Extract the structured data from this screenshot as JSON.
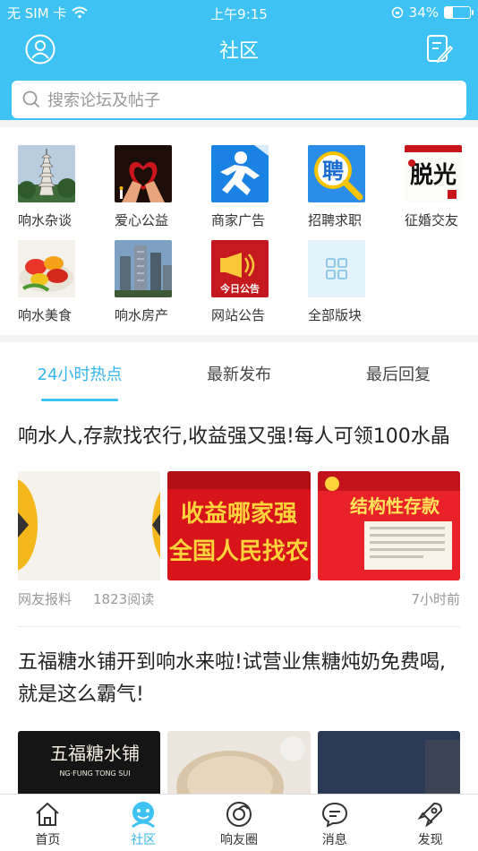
{
  "status": {
    "carrier": "无 SIM 卡",
    "time": "上午9:15",
    "battery": "34%"
  },
  "nav": {
    "title": "社区"
  },
  "search": {
    "placeholder": "搜索论坛及帖子"
  },
  "categories": [
    {
      "label": "响水杂谈",
      "icon": "pagoda-icon"
    },
    {
      "label": "爱心公益",
      "icon": "heart-hands-icon"
    },
    {
      "label": "商家广告",
      "icon": "runner-icon"
    },
    {
      "label": "招聘求职",
      "icon": "hire-icon",
      "text": "聘"
    },
    {
      "label": "征婚交友",
      "icon": "calligraphy-icon",
      "text": "脱光"
    },
    {
      "label": "响水美食",
      "icon": "food-icon"
    },
    {
      "label": "响水房产",
      "icon": "buildings-icon"
    },
    {
      "label": "网站公告",
      "icon": "megaphone-icon",
      "text": "今日公告"
    },
    {
      "label": "全部版块",
      "icon": "grid-icon"
    }
  ],
  "tabs": [
    {
      "label": "24小时热点",
      "active": true
    },
    {
      "label": "最新发布",
      "active": false
    },
    {
      "label": "最后回复",
      "active": false
    }
  ],
  "posts": [
    {
      "title": "响水人,存款找农行,收益强又强!每人可领100水晶",
      "source": "网友报料",
      "reads": "1823阅读",
      "time": "7小时前",
      "img2_text": "收益哪家强",
      "img2_text2": "全国人民找农",
      "img3_text": "结构性存款"
    },
    {
      "title": "五福糖水铺开到响水来啦!试营业焦糖炖奶免费喝,就是这么霸气!",
      "img1_text": "五福糖水铺",
      "img1_sub": "NG·FUNG TONG SUI"
    }
  ],
  "bottom_nav": [
    {
      "label": "首页",
      "icon": "home-icon",
      "active": false
    },
    {
      "label": "社区",
      "icon": "community-icon",
      "active": true
    },
    {
      "label": "响友圈",
      "icon": "circle-icon",
      "active": false
    },
    {
      "label": "消息",
      "icon": "message-icon",
      "active": false
    },
    {
      "label": "发现",
      "icon": "rocket-icon",
      "active": false
    }
  ],
  "colors": {
    "primary": "#3ec2f4",
    "active_text": "#34b5ec"
  }
}
